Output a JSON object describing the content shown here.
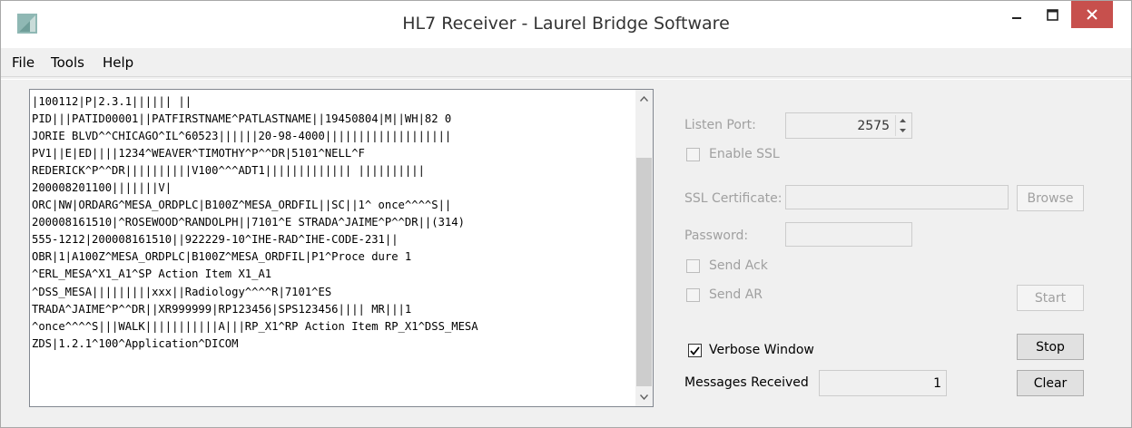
{
  "window": {
    "title": "HL7 Receiver - Laurel Bridge Software",
    "controls": {
      "minimize": "‒",
      "maximize": "☐",
      "close": "✕"
    }
  },
  "menu": {
    "file": "File",
    "tools": "Tools",
    "help": "Help"
  },
  "message_lines": [
    "|100112|P|2.3.1|||||| ||",
    "PID|||PATID00001||PATFIRSTNAME^PATLASTNAME||19450804|M||WH|82 0",
    "JORIE BLVD^^CHICAGO^IL^60523||||||20-98-4000|||||||||||||||||||",
    "PV1||E|ED||||1234^WEAVER^TIMOTHY^P^^DR|5101^NELL^F",
    "REDERICK^P^^DR||||||||||V100^^^ADT1||||||||||||| ||||||||||",
    "200008201100|||||||V|",
    "ORC|NW|ORDARG^MESA_ORDPLC|B100Z^MESA_ORDFIL||SC||1^ once^^^^S||",
    "200008161510|^ROSEWOOD^RANDOLPH||7101^E STRADA^JAIME^P^^DR||(314)",
    "555-1212|200008161510||922229-10^IHE-RAD^IHE-CODE-231||",
    "OBR|1|A100Z^MESA_ORDPLC|B100Z^MESA_ORDFIL|P1^Proce dure 1",
    "^ERL_MESA^X1_A1^SP Action Item X1_A1",
    "^DSS_MESA|||||||||xxx||Radiology^^^^R|7101^ES",
    "TRADA^JAIME^P^^DR||XR999999|RP123456|SPS123456|||| MR|||1",
    "^once^^^^S|||WALK|||||||||||A|||RP_X1^RP Action Item RP_X1^DSS_MESA",
    "ZDS|1.2.1^100^Application^DICOM"
  ],
  "settings": {
    "listen_port_label": "Listen Port:",
    "listen_port_value": "2575",
    "enable_ssl_label": "Enable SSL",
    "ssl_certificate_label": "SSL Certificate:",
    "ssl_certificate_value": "",
    "browse_label": "Browse",
    "password_label": "Password:",
    "password_value": "",
    "send_ack_label": "Send Ack",
    "send_ar_label": "Send AR",
    "start_label": "Start",
    "verbose_label": "Verbose Window",
    "verbose_checked": true,
    "stop_label": "Stop",
    "messages_received_label": "Messages Received",
    "messages_received_value": "1",
    "clear_label": "Clear"
  },
  "icons": {
    "app": "laurel-bridge-app-icon",
    "scroll_up": "chevron-up-icon",
    "scroll_down": "chevron-down-icon",
    "spin_up": "spin-up-icon",
    "spin_down": "spin-down-icon",
    "check": "check-icon"
  },
  "colors": {
    "close_button": "#c7504d",
    "disabled_text": "#a0a0a0"
  }
}
